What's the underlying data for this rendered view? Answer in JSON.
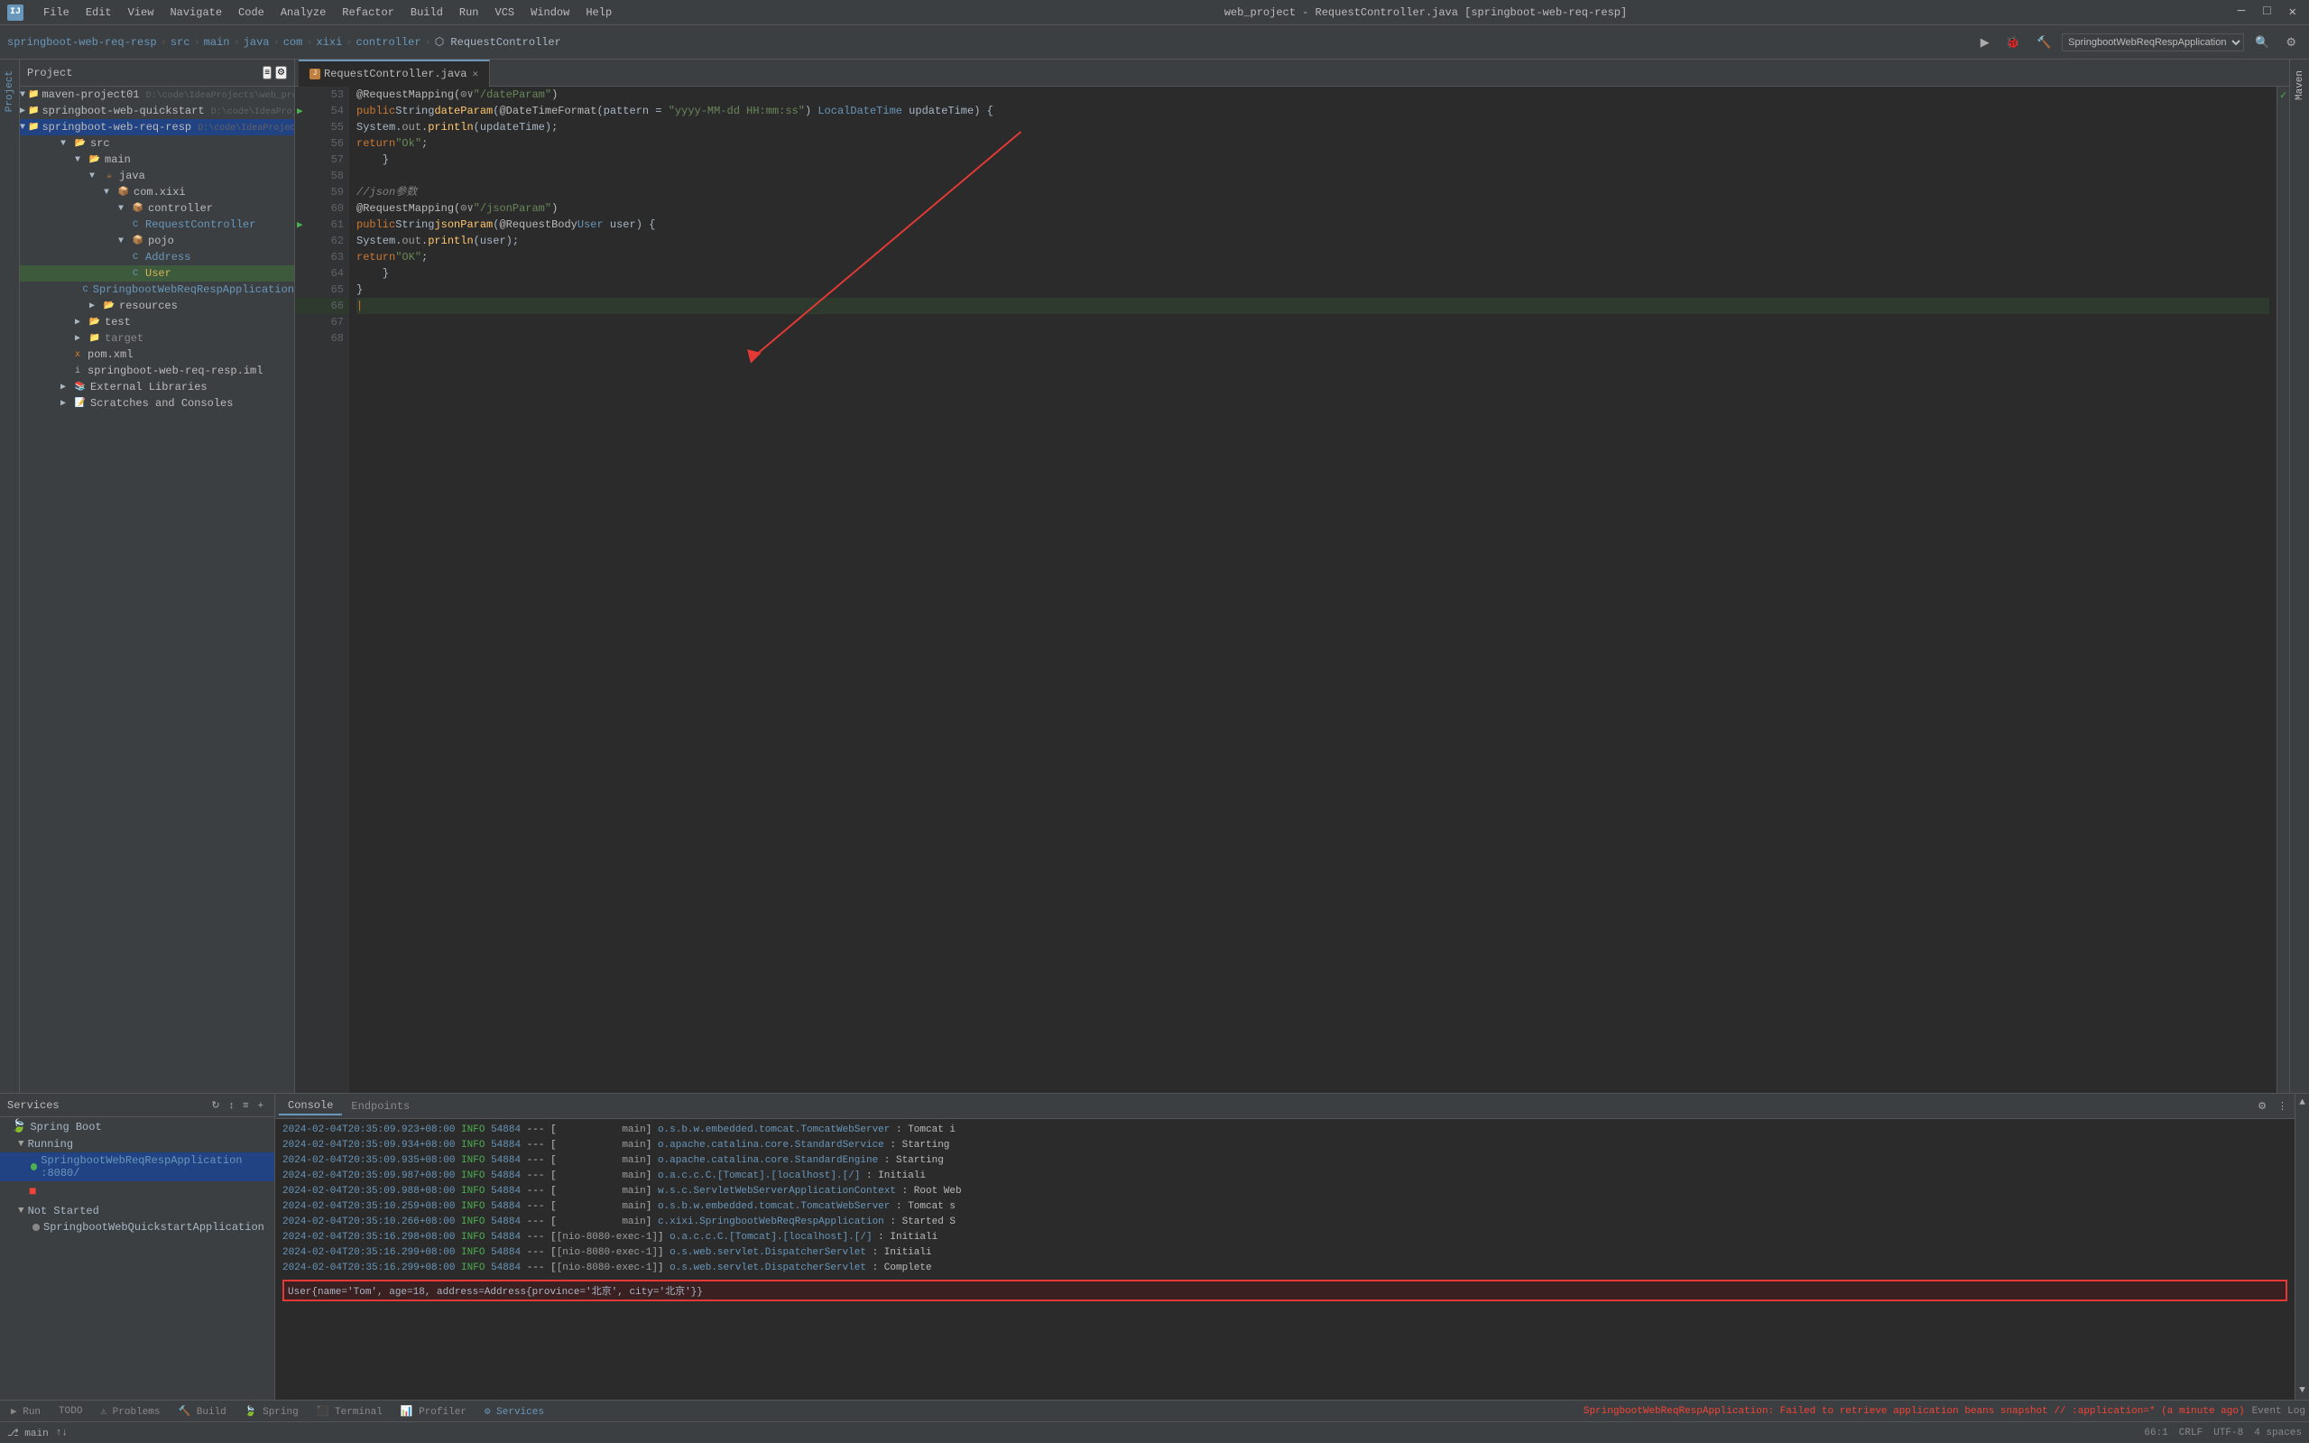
{
  "window": {
    "title": "web_project - RequestController.java [springboot-web-req-resp]",
    "menu_items": [
      "File",
      "Edit",
      "View",
      "Navigate",
      "Code",
      "Analyze",
      "Refactor",
      "Build",
      "Run",
      "VCS",
      "Window",
      "Help"
    ]
  },
  "breadcrumb": {
    "items": [
      "springboot-web-req-resp",
      "src",
      "main",
      "java",
      "com",
      "xixi",
      "controller",
      "RequestController"
    ]
  },
  "tab": {
    "filename": "RequestController.java",
    "modified": false
  },
  "project": {
    "label": "Project",
    "nodes": [
      {
        "label": "maven-project01",
        "path": "D:\\code\\IdeaProjects\\web_project",
        "indent": 0,
        "type": "folder",
        "expanded": true
      },
      {
        "label": "springboot-web-quickstart",
        "path": "D:\\code\\IdeaProjects\\we",
        "indent": 1,
        "type": "folder",
        "expanded": false
      },
      {
        "label": "springboot-web-req-resp",
        "path": "D:\\code\\IdeaProjects\\we",
        "indent": 1,
        "type": "folder",
        "expanded": true,
        "selected": true
      },
      {
        "label": "src",
        "indent": 2,
        "type": "folder",
        "expanded": true
      },
      {
        "label": "main",
        "indent": 3,
        "type": "folder",
        "expanded": true
      },
      {
        "label": "java",
        "indent": 4,
        "type": "folder",
        "expanded": true
      },
      {
        "label": "com.xixi",
        "indent": 5,
        "type": "folder",
        "expanded": true
      },
      {
        "label": "controller",
        "indent": 6,
        "type": "folder",
        "expanded": true
      },
      {
        "label": "RequestController",
        "indent": 7,
        "type": "java-class"
      },
      {
        "label": "pojo",
        "indent": 6,
        "type": "folder",
        "expanded": true
      },
      {
        "label": "Address",
        "indent": 7,
        "type": "java-class"
      },
      {
        "label": "User",
        "indent": 7,
        "type": "java-class",
        "selected": true
      },
      {
        "label": "SpringbootWebReqRespApplication",
        "indent": 6,
        "type": "java-class"
      },
      {
        "label": "resources",
        "indent": 5,
        "type": "folder",
        "expanded": false
      },
      {
        "label": "test",
        "indent": 4,
        "type": "folder",
        "expanded": false
      },
      {
        "label": "target",
        "indent": 3,
        "type": "folder",
        "expanded": false
      },
      {
        "label": "pom.xml",
        "indent": 3,
        "type": "xml"
      },
      {
        "label": "springboot-web-req-resp.iml",
        "indent": 3,
        "type": "iml"
      },
      {
        "label": "External Libraries",
        "indent": 2,
        "type": "lib"
      },
      {
        "label": "Scratches and Consoles",
        "indent": 2,
        "type": "scratch"
      }
    ]
  },
  "code": {
    "lines": [
      {
        "num": 53,
        "content": "    @RequestMapping(☉∨\"/dateParam\")"
      },
      {
        "num": 54,
        "content": "    public String dateParam(@DateTimeFormat(pattern = \"yyyy-MM-dd HH:mm:ss\") LocalDateTime updateTime) {",
        "has_run": true
      },
      {
        "num": 55,
        "content": "        System.out.println(updateTime);"
      },
      {
        "num": 56,
        "content": "        return \"Ok\";"
      },
      {
        "num": 57,
        "content": "    }"
      },
      {
        "num": 58,
        "content": ""
      },
      {
        "num": 59,
        "content": "    //json参数"
      },
      {
        "num": 60,
        "content": "    @RequestMapping(☉∨\"/jsonParam\")"
      },
      {
        "num": 61,
        "content": "    public String jsonParam(@RequestBody User user) {",
        "has_run": true
      },
      {
        "num": 62,
        "content": "        System.out.println(user);"
      },
      {
        "num": 63,
        "content": "        return \"OK\";"
      },
      {
        "num": 64,
        "content": "    }"
      },
      {
        "num": 65,
        "content": "}"
      },
      {
        "num": 66,
        "content": ""
      },
      {
        "num": 67,
        "content": ""
      },
      {
        "num": 68,
        "content": ""
      }
    ]
  },
  "services": {
    "label": "Services",
    "tree": [
      {
        "label": "Spring Boot",
        "indent": 0,
        "type": "group",
        "expanded": true
      },
      {
        "label": "Running",
        "indent": 1,
        "type": "group",
        "expanded": true
      },
      {
        "label": "SpringbootWebReqRespApplication :8080/",
        "indent": 2,
        "type": "running"
      },
      {
        "label": "Not Started",
        "indent": 1,
        "type": "group",
        "expanded": true
      },
      {
        "label": "SpringbootWebQuickstartApplication",
        "indent": 2,
        "type": "stopped"
      }
    ]
  },
  "console": {
    "tabs": [
      "Console",
      "Endpoints"
    ],
    "active_tab": "Console",
    "log_lines": [
      {
        "ts": "2024-02-04T20:35:09.923+08:00",
        "level": "INFO",
        "pid": "54884",
        "sep": "---",
        "thread": "main",
        "class": "o.s.b.w.embedded.tomcat.TomcatWebServer",
        "msg": ": Tomcat i"
      },
      {
        "ts": "2024-02-04T20:35:09.934+08:00",
        "level": "INFO",
        "pid": "54884",
        "sep": "---",
        "thread": "main",
        "class": "o.apache.catalina.core.StandardService",
        "msg": ": Starting"
      },
      {
        "ts": "2024-02-04T20:35:09.935+08:00",
        "level": "INFO",
        "pid": "54884",
        "sep": "---",
        "thread": "main",
        "class": "o.apache.catalina.core.StandardEngine",
        "msg": ": Starting"
      },
      {
        "ts": "2024-02-04T20:35:09.987+08:00",
        "level": "INFO",
        "pid": "54884",
        "sep": "---",
        "thread": "main",
        "class": "o.a.c.c.C.[Tomcat].[localhost].[/]",
        "msg": ": Initiali"
      },
      {
        "ts": "2024-02-04T20:35:09.988+08:00",
        "level": "INFO",
        "pid": "54884",
        "sep": "---",
        "thread": "main",
        "class": "w.s.c.ServletWebServerApplicationContext",
        "msg": ": Root Web"
      },
      {
        "ts": "2024-02-04T20:35:10.259+08:00",
        "level": "INFO",
        "pid": "54884",
        "sep": "---",
        "thread": "main",
        "class": "o.s.b.w.embedded.tomcat.TomcatWebServer",
        "msg": ": Tomcat s"
      },
      {
        "ts": "2024-02-04T20:35:10.266+08:00",
        "level": "INFO",
        "pid": "54884",
        "sep": "---",
        "thread": "main",
        "class": "c.xixi.SpringbootWebReqRespApplication",
        "msg": ": Started S"
      },
      {
        "ts": "2024-02-04T20:35:16.298+08:00",
        "level": "INFO",
        "pid": "54884",
        "sep": "---",
        "thread": "[nio-8080-exec-1]",
        "class": "o.a.c.c.C.[Tomcat].[localhost].[/]",
        "msg": ": Initiali"
      },
      {
        "ts": "2024-02-04T20:35:16.299+08:00",
        "level": "INFO",
        "pid": "54884",
        "sep": "---",
        "thread": "[nio-8080-exec-1]",
        "class": "o.s.web.servlet.DispatcherServlet",
        "msg": ": Initiali"
      },
      {
        "ts": "2024-02-04T20:35:16.299+08:00",
        "level": "INFO",
        "pid": "54884",
        "sep": "---",
        "thread": "[nio-8080-exec-1]",
        "class": "o.s.web.servlet.DispatcherServlet",
        "msg": ": Complete"
      }
    ],
    "highlighted_line": "User{name='Tom', age=18, address=Address{province='北京', city='北京'}}"
  },
  "statusbar": {
    "error_msg": "SpringbootWebReqRespApplication: Failed to retrieve application beans snapshot",
    "error_detail": "// :application=* (a minute ago)",
    "position": "66:1",
    "crlf": "CRLF",
    "encoding": "UTF-8",
    "indent": "4 spaces"
  },
  "bottom_tabs": [
    "Run",
    "TODO",
    "Problems",
    "Build",
    "Spring",
    "Terminal",
    "Profiler",
    "Services"
  ],
  "active_bottom_tab": "Services"
}
